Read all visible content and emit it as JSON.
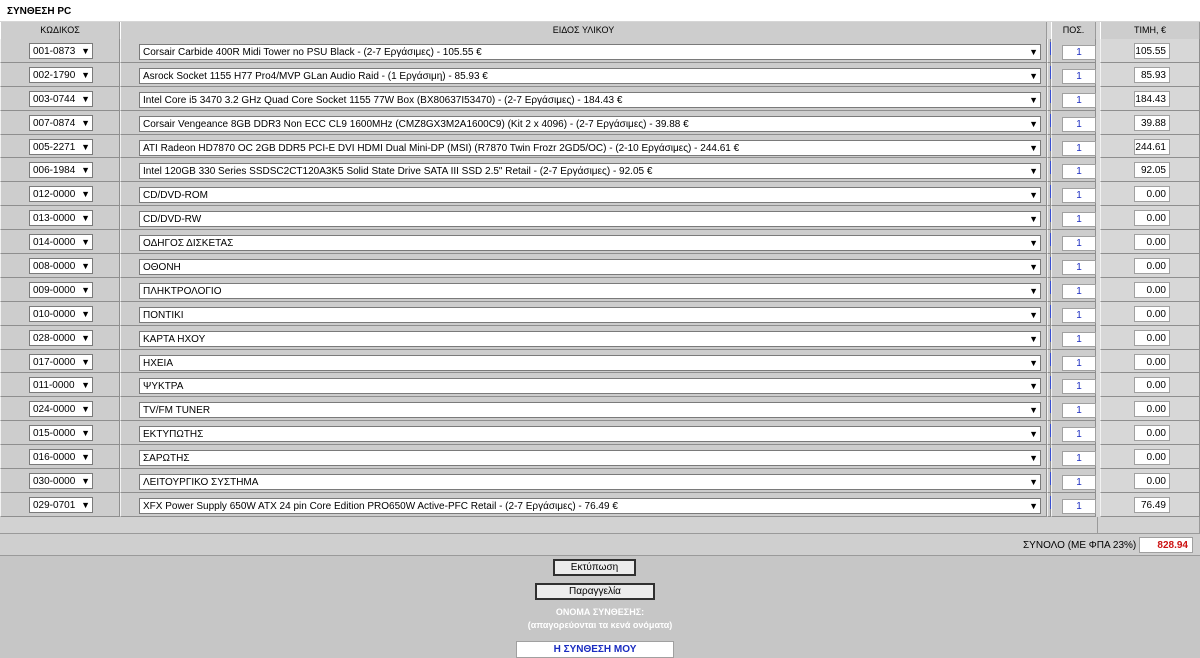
{
  "title": "ΣΥΝΘΕΣΗ PC",
  "headers": {
    "code": "ΚΩΔΙΚΟΣ",
    "item": "ΕΙΔΟΣ ΥΛΙΚΟΥ",
    "qty": "ΠΟΣ.",
    "price": "ΤΙΜΗ, €"
  },
  "info_glyph": "[i]",
  "rows": [
    {
      "code": "001-0873",
      "item": "Corsair Carbide 400R Midi Tower no PSU Black - (2-7 Εργάσιμες) - 105.55 €",
      "qty": "1",
      "price": "105.55"
    },
    {
      "code": "002-1790",
      "item": "Asrock Socket 1155 H77 Pro4/MVP GLan Audio Raid - (1 Εργάσιμη) - 85.93 €",
      "qty": "1",
      "price": "85.93"
    },
    {
      "code": "003-0744",
      "item": "Intel Core i5 3470 3.2 GHz Quad Core Socket 1155 77W Box (BX80637I53470) - (2-7 Εργάσιμες) - 184.43 €",
      "qty": "1",
      "price": "184.43"
    },
    {
      "code": "007-0874",
      "item": "Corsair Vengeance 8GB DDR3 Non ECC CL9 1600MHz (CMZ8GX3M2A1600C9) (Kit 2 x 4096) - (2-7 Εργάσιμες) - 39.88 €",
      "qty": "1",
      "price": "39.88"
    },
    {
      "code": "005-2271",
      "item": "ATI Radeon HD7870 OC 2GB DDR5 PCI-E DVI HDMI Dual Mini-DP (MSI) (R7870 Twin Frozr 2GD5/OC) - (2-10 Εργάσιμες) - 244.61 €",
      "qty": "1",
      "price": "244.61"
    },
    {
      "code": "006-1984",
      "item": "Intel 120GB 330 Series SSDSC2CT120A3K5 Solid State Drive SATA III SSD 2.5\" Retail - (2-7 Εργάσιμες) - 92.05 €",
      "qty": "1",
      "price": "92.05"
    },
    {
      "code": "012-0000",
      "item": "CD/DVD-ROM",
      "qty": "1",
      "price": "0.00"
    },
    {
      "code": "013-0000",
      "item": "CD/DVD-RW",
      "qty": "1",
      "price": "0.00"
    },
    {
      "code": "014-0000",
      "item": "ΟΔΗΓΟΣ ΔΙΣΚΕΤΑΣ",
      "qty": "1",
      "price": "0.00"
    },
    {
      "code": "008-0000",
      "item": "ΟΘΟΝΗ",
      "qty": "1",
      "price": "0.00"
    },
    {
      "code": "009-0000",
      "item": "ΠΛΗΚΤΡΟΛΟΓΙΟ",
      "qty": "1",
      "price": "0.00"
    },
    {
      "code": "010-0000",
      "item": "ΠΟΝΤΙΚΙ",
      "qty": "1",
      "price": "0.00"
    },
    {
      "code": "028-0000",
      "item": "ΚΑΡΤΑ ΗΧΟΥ",
      "qty": "1",
      "price": "0.00"
    },
    {
      "code": "017-0000",
      "item": "ΗΧΕΙΑ",
      "qty": "1",
      "price": "0.00"
    },
    {
      "code": "011-0000",
      "item": "ΨΥΚΤΡΑ",
      "qty": "1",
      "price": "0.00"
    },
    {
      "code": "024-0000",
      "item": "TV/FM TUNER",
      "qty": "1",
      "price": "0.00"
    },
    {
      "code": "015-0000",
      "item": "ΕΚΤΥΠΩΤΗΣ",
      "qty": "1",
      "price": "0.00"
    },
    {
      "code": "016-0000",
      "item": "ΣΑΡΩΤΗΣ",
      "qty": "1",
      "price": "0.00"
    },
    {
      "code": "030-0000",
      "item": "ΛΕΙΤΟΥΡΓΙΚΟ ΣΥΣΤΗΜΑ",
      "qty": "1",
      "price": "0.00"
    },
    {
      "code": "029-0701",
      "item": "XFX Power Supply 650W ATX 24 pin Core Edition PRO650W Active-PFC Retail - (2-7 Εργάσιμες) - 76.49 €",
      "qty": "1",
      "price": "76.49"
    }
  ],
  "total": {
    "label": "ΣΥΝΟΛΟ (ΜΕ ΦΠΑ 23%)",
    "value": "828.94"
  },
  "buttons": {
    "print": "Εκτύπωση",
    "order": "Παραγγελία"
  },
  "build_name": {
    "label": "ΟΝΟΜΑ ΣΥΝΘΕΣΗΣ:",
    "note": "(απαγορεύονται τα κενά ονόματα)",
    "value": "Η ΣΥΝΘΕΣΗ ΜΟΥ"
  },
  "colors": {
    "total_value": "#cc1111",
    "info_icon": "#2233bb",
    "qty_text": "#1a2cc0"
  }
}
